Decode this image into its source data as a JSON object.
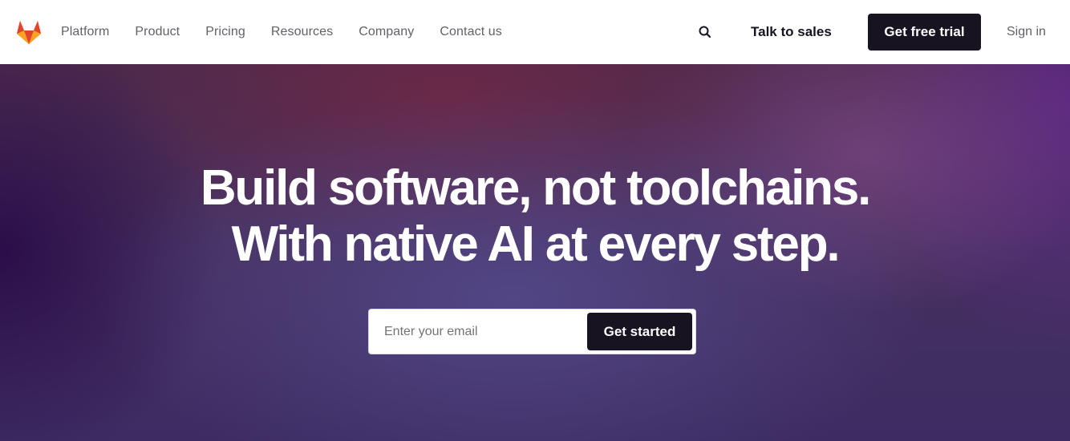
{
  "nav": {
    "logo_icon": "gitlab-tanuki-icon",
    "links": [
      "Platform",
      "Product",
      "Pricing",
      "Resources",
      "Company",
      "Contact us"
    ],
    "search_icon": "search-icon",
    "talk_to_sales": "Talk to sales",
    "free_trial": "Get free trial",
    "sign_in": "Sign in"
  },
  "hero": {
    "title_line1": "Build software, not toolchains.",
    "title_line2": "With native AI at every step.",
    "email_placeholder": "Enter your email",
    "cta": "Get started"
  },
  "colors": {
    "primary_dark": "#171321",
    "nav_text": "#626168",
    "logo_orange": "#fc6d26",
    "logo_red": "#e24329",
    "logo_amber": "#fca326",
    "hero_bg": "#45305e"
  }
}
